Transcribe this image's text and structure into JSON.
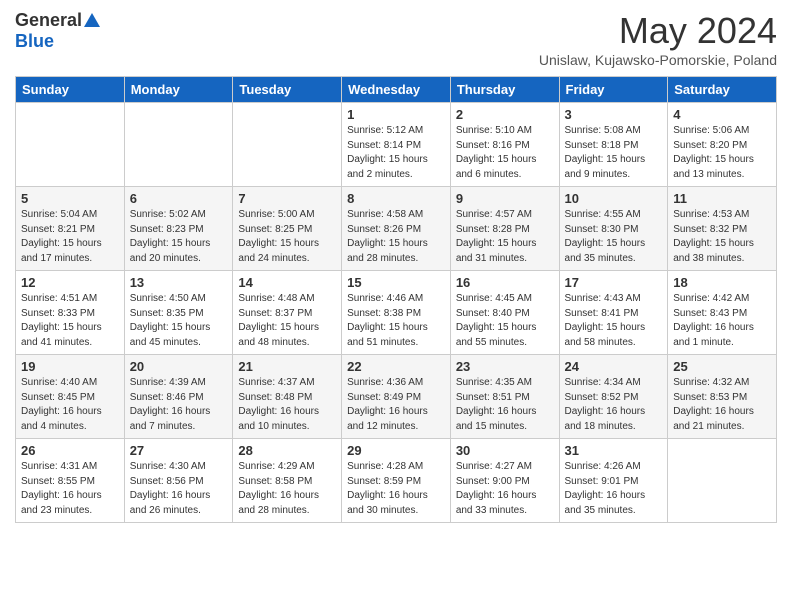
{
  "logo": {
    "general": "General",
    "blue": "Blue"
  },
  "header": {
    "month_year": "May 2024",
    "location": "Unislaw, Kujawsko-Pomorskie, Poland"
  },
  "weekdays": [
    "Sunday",
    "Monday",
    "Tuesday",
    "Wednesday",
    "Thursday",
    "Friday",
    "Saturday"
  ],
  "weeks": [
    [
      {
        "day": "",
        "sunrise": "",
        "sunset": "",
        "daylight": ""
      },
      {
        "day": "",
        "sunrise": "",
        "sunset": "",
        "daylight": ""
      },
      {
        "day": "",
        "sunrise": "",
        "sunset": "",
        "daylight": ""
      },
      {
        "day": "1",
        "sunrise": "Sunrise: 5:12 AM",
        "sunset": "Sunset: 8:14 PM",
        "daylight": "Daylight: 15 hours and 2 minutes."
      },
      {
        "day": "2",
        "sunrise": "Sunrise: 5:10 AM",
        "sunset": "Sunset: 8:16 PM",
        "daylight": "Daylight: 15 hours and 6 minutes."
      },
      {
        "day": "3",
        "sunrise": "Sunrise: 5:08 AM",
        "sunset": "Sunset: 8:18 PM",
        "daylight": "Daylight: 15 hours and 9 minutes."
      },
      {
        "day": "4",
        "sunrise": "Sunrise: 5:06 AM",
        "sunset": "Sunset: 8:20 PM",
        "daylight": "Daylight: 15 hours and 13 minutes."
      }
    ],
    [
      {
        "day": "5",
        "sunrise": "Sunrise: 5:04 AM",
        "sunset": "Sunset: 8:21 PM",
        "daylight": "Daylight: 15 hours and 17 minutes."
      },
      {
        "day": "6",
        "sunrise": "Sunrise: 5:02 AM",
        "sunset": "Sunset: 8:23 PM",
        "daylight": "Daylight: 15 hours and 20 minutes."
      },
      {
        "day": "7",
        "sunrise": "Sunrise: 5:00 AM",
        "sunset": "Sunset: 8:25 PM",
        "daylight": "Daylight: 15 hours and 24 minutes."
      },
      {
        "day": "8",
        "sunrise": "Sunrise: 4:58 AM",
        "sunset": "Sunset: 8:26 PM",
        "daylight": "Daylight: 15 hours and 28 minutes."
      },
      {
        "day": "9",
        "sunrise": "Sunrise: 4:57 AM",
        "sunset": "Sunset: 8:28 PM",
        "daylight": "Daylight: 15 hours and 31 minutes."
      },
      {
        "day": "10",
        "sunrise": "Sunrise: 4:55 AM",
        "sunset": "Sunset: 8:30 PM",
        "daylight": "Daylight: 15 hours and 35 minutes."
      },
      {
        "day": "11",
        "sunrise": "Sunrise: 4:53 AM",
        "sunset": "Sunset: 8:32 PM",
        "daylight": "Daylight: 15 hours and 38 minutes."
      }
    ],
    [
      {
        "day": "12",
        "sunrise": "Sunrise: 4:51 AM",
        "sunset": "Sunset: 8:33 PM",
        "daylight": "Daylight: 15 hours and 41 minutes."
      },
      {
        "day": "13",
        "sunrise": "Sunrise: 4:50 AM",
        "sunset": "Sunset: 8:35 PM",
        "daylight": "Daylight: 15 hours and 45 minutes."
      },
      {
        "day": "14",
        "sunrise": "Sunrise: 4:48 AM",
        "sunset": "Sunset: 8:37 PM",
        "daylight": "Daylight: 15 hours and 48 minutes."
      },
      {
        "day": "15",
        "sunrise": "Sunrise: 4:46 AM",
        "sunset": "Sunset: 8:38 PM",
        "daylight": "Daylight: 15 hours and 51 minutes."
      },
      {
        "day": "16",
        "sunrise": "Sunrise: 4:45 AM",
        "sunset": "Sunset: 8:40 PM",
        "daylight": "Daylight: 15 hours and 55 minutes."
      },
      {
        "day": "17",
        "sunrise": "Sunrise: 4:43 AM",
        "sunset": "Sunset: 8:41 PM",
        "daylight": "Daylight: 15 hours and 58 minutes."
      },
      {
        "day": "18",
        "sunrise": "Sunrise: 4:42 AM",
        "sunset": "Sunset: 8:43 PM",
        "daylight": "Daylight: 16 hours and 1 minute."
      }
    ],
    [
      {
        "day": "19",
        "sunrise": "Sunrise: 4:40 AM",
        "sunset": "Sunset: 8:45 PM",
        "daylight": "Daylight: 16 hours and 4 minutes."
      },
      {
        "day": "20",
        "sunrise": "Sunrise: 4:39 AM",
        "sunset": "Sunset: 8:46 PM",
        "daylight": "Daylight: 16 hours and 7 minutes."
      },
      {
        "day": "21",
        "sunrise": "Sunrise: 4:37 AM",
        "sunset": "Sunset: 8:48 PM",
        "daylight": "Daylight: 16 hours and 10 minutes."
      },
      {
        "day": "22",
        "sunrise": "Sunrise: 4:36 AM",
        "sunset": "Sunset: 8:49 PM",
        "daylight": "Daylight: 16 hours and 12 minutes."
      },
      {
        "day": "23",
        "sunrise": "Sunrise: 4:35 AM",
        "sunset": "Sunset: 8:51 PM",
        "daylight": "Daylight: 16 hours and 15 minutes."
      },
      {
        "day": "24",
        "sunrise": "Sunrise: 4:34 AM",
        "sunset": "Sunset: 8:52 PM",
        "daylight": "Daylight: 16 hours and 18 minutes."
      },
      {
        "day": "25",
        "sunrise": "Sunrise: 4:32 AM",
        "sunset": "Sunset: 8:53 PM",
        "daylight": "Daylight: 16 hours and 21 minutes."
      }
    ],
    [
      {
        "day": "26",
        "sunrise": "Sunrise: 4:31 AM",
        "sunset": "Sunset: 8:55 PM",
        "daylight": "Daylight: 16 hours and 23 minutes."
      },
      {
        "day": "27",
        "sunrise": "Sunrise: 4:30 AM",
        "sunset": "Sunset: 8:56 PM",
        "daylight": "Daylight: 16 hours and 26 minutes."
      },
      {
        "day": "28",
        "sunrise": "Sunrise: 4:29 AM",
        "sunset": "Sunset: 8:58 PM",
        "daylight": "Daylight: 16 hours and 28 minutes."
      },
      {
        "day": "29",
        "sunrise": "Sunrise: 4:28 AM",
        "sunset": "Sunset: 8:59 PM",
        "daylight": "Daylight: 16 hours and 30 minutes."
      },
      {
        "day": "30",
        "sunrise": "Sunrise: 4:27 AM",
        "sunset": "Sunset: 9:00 PM",
        "daylight": "Daylight: 16 hours and 33 minutes."
      },
      {
        "day": "31",
        "sunrise": "Sunrise: 4:26 AM",
        "sunset": "Sunset: 9:01 PM",
        "daylight": "Daylight: 16 hours and 35 minutes."
      },
      {
        "day": "",
        "sunrise": "",
        "sunset": "",
        "daylight": ""
      }
    ]
  ]
}
